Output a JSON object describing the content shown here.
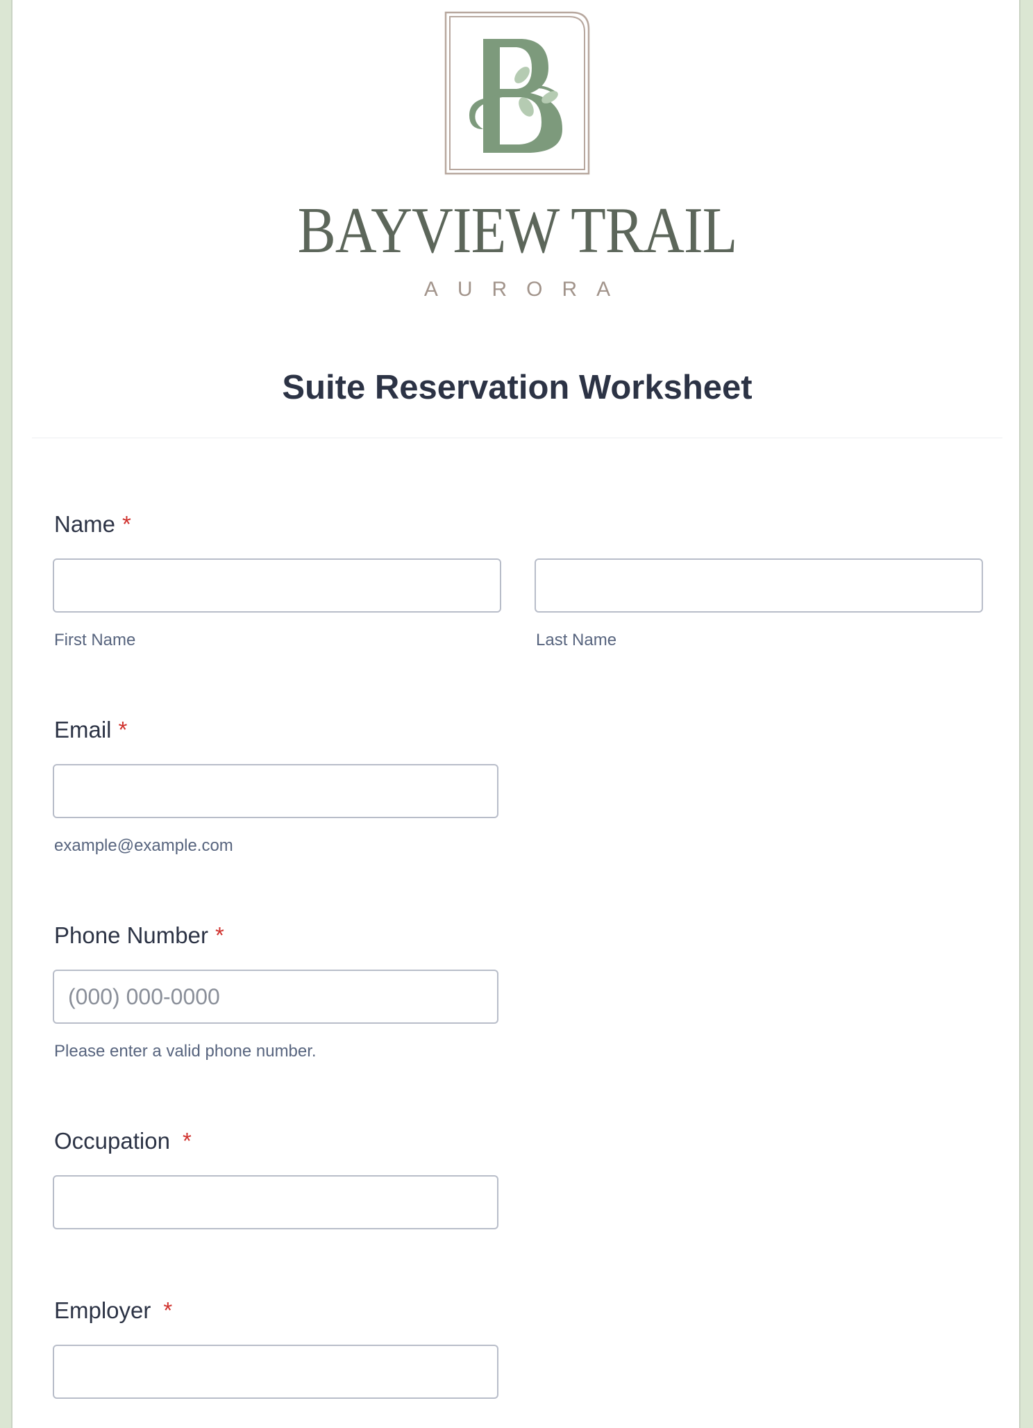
{
  "brand": {
    "name": "BAYVIEW TRAIL",
    "sub": "AURORA",
    "colors": {
      "mark": "#7d9a7c",
      "frame": "#b7a79e",
      "name": "#5c665a",
      "sub": "#a2948b"
    }
  },
  "form": {
    "title": "Suite Reservation Worksheet",
    "required_mark": "*",
    "fields": {
      "name": {
        "label": "Name",
        "first_sublabel": "First Name",
        "last_sublabel": "Last Name",
        "first_value": "",
        "last_value": ""
      },
      "email": {
        "label": "Email",
        "sublabel": "example@example.com",
        "value": ""
      },
      "phone": {
        "label": "Phone Number",
        "placeholder": "(000) 000-0000",
        "sublabel": "Please enter a valid phone number.",
        "value": ""
      },
      "occupation": {
        "label": "Occupation",
        "value": ""
      },
      "employer": {
        "label": "Employer",
        "value": ""
      }
    }
  },
  "theme": {
    "background": "#dbe6d3",
    "required_color": "#d0312d",
    "label_color": "#2c3345"
  }
}
